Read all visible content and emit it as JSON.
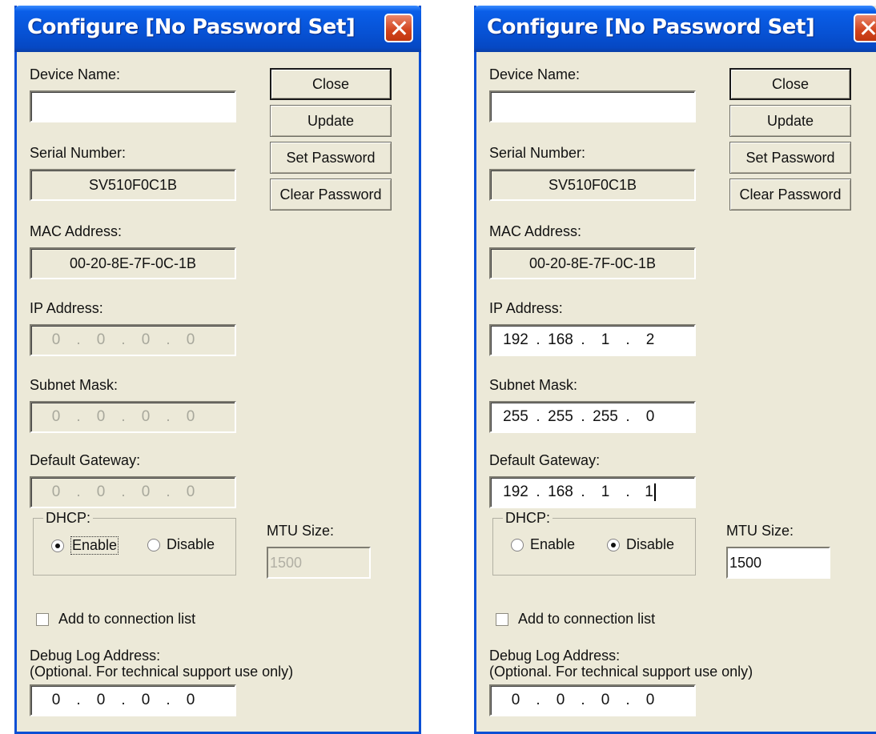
{
  "dialogs": [
    {
      "title": "Configure  [No Password Set]",
      "labels": {
        "device_name": "Device Name:",
        "serial_number": "Serial Number:",
        "mac_address": "MAC Address:",
        "ip_address": "IP Address:",
        "subnet_mask": "Subnet Mask:",
        "default_gateway": "Default Gateway:",
        "dhcp": "DHCP:",
        "mtu_size": "MTU Size:",
        "debug_log": "Debug Log Address:",
        "debug_note": "(Optional. For technical support use only)"
      },
      "buttons": {
        "close": "Close",
        "update": "Update",
        "set_password": "Set Password",
        "clear_password": "Clear Password"
      },
      "device_name": "",
      "serial_number": "SV510F0C1B",
      "mac_address": "00-20-8E-7F-0C-1B",
      "ip_address": [
        "0",
        "0",
        "0",
        "0"
      ],
      "subnet_mask": [
        "0",
        "0",
        "0",
        "0"
      ],
      "default_gateway": [
        "0",
        "0",
        "0",
        "0"
      ],
      "dhcp_enable_label": "Enable",
      "dhcp_disable_label": "Disable",
      "dhcp_selected": "Enable",
      "mtu_size": "1500",
      "fields_enabled": false,
      "add_to_connection_label": "Add to connection list",
      "add_to_connection_checked": false,
      "debug_log_address": [
        "0",
        "0",
        "0",
        "0"
      ]
    },
    {
      "title": "Configure  [No Password Set]",
      "labels": {
        "device_name": "Device Name:",
        "serial_number": "Serial Number:",
        "mac_address": "MAC Address:",
        "ip_address": "IP Address:",
        "subnet_mask": "Subnet Mask:",
        "default_gateway": "Default Gateway:",
        "dhcp": "DHCP:",
        "mtu_size": "MTU Size:",
        "debug_log": "Debug Log Address:",
        "debug_note": "(Optional. For technical support use only)"
      },
      "buttons": {
        "close": "Close",
        "update": "Update",
        "set_password": "Set Password",
        "clear_password": "Clear Password"
      },
      "device_name": "",
      "serial_number": "SV510F0C1B",
      "mac_address": "00-20-8E-7F-0C-1B",
      "ip_address": [
        "192",
        "168",
        "1",
        "2"
      ],
      "subnet_mask": [
        "255",
        "255",
        "255",
        "0"
      ],
      "default_gateway": [
        "192",
        "168",
        "1",
        "1"
      ],
      "dhcp_enable_label": "Enable",
      "dhcp_disable_label": "Disable",
      "dhcp_selected": "Disable",
      "mtu_size": "1500",
      "fields_enabled": true,
      "add_to_connection_label": "Add to connection list",
      "add_to_connection_checked": false,
      "debug_log_address": [
        "0",
        "0",
        "0",
        "0"
      ]
    }
  ],
  "icons": {
    "close": "close-x-icon",
    "radio": "radio-icon",
    "checkbox": "checkbox-icon"
  },
  "colors": {
    "titlebar": "#0753d6",
    "dialog_bg": "#ece9d8",
    "close_button": "#d2431c"
  }
}
